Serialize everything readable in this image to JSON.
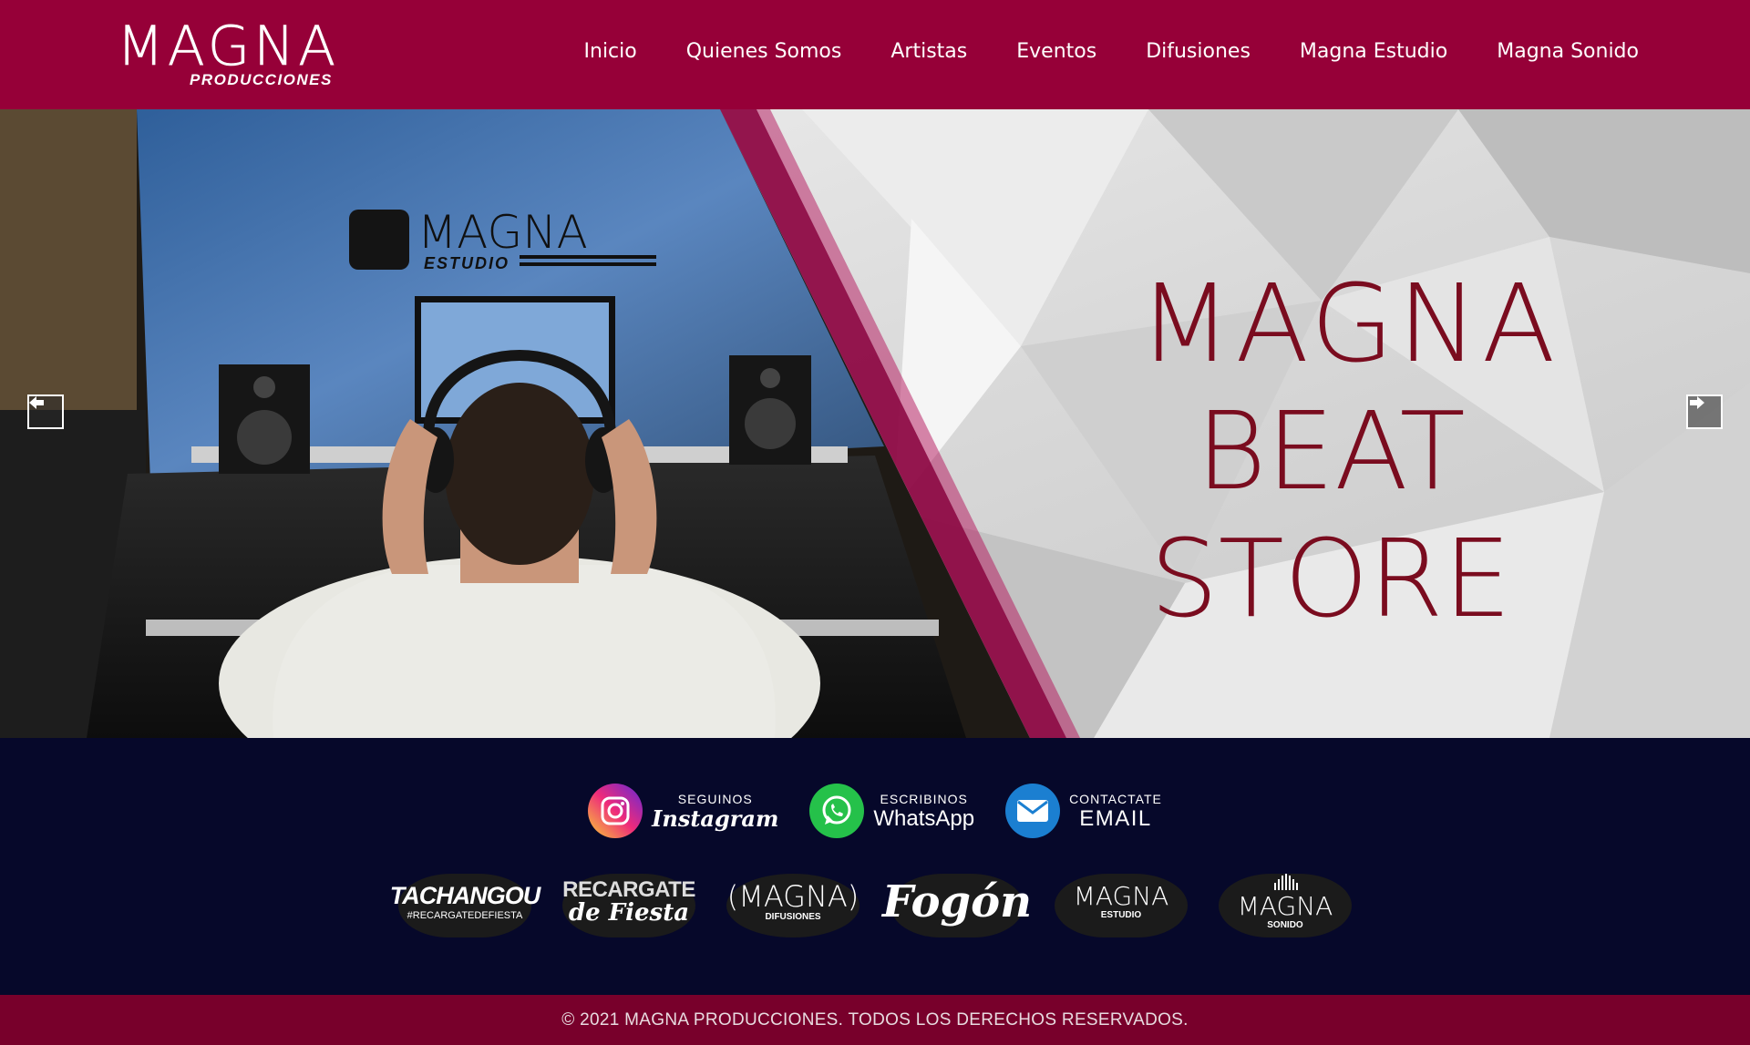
{
  "brand": {
    "name": "MAGNA",
    "subtitle": "PRODUCCIONES"
  },
  "nav": [
    "Inicio",
    "Quienes Somos",
    "Artistas",
    "Eventos",
    "Difusiones",
    "Magna Estudio",
    "Magna Sonido"
  ],
  "hero": {
    "photo_sign_main": "MAGNA",
    "photo_sign_sub": "ESTUDIO",
    "title_line1": "MAGNA",
    "title_line2": "BEAT STORE"
  },
  "social": [
    {
      "top": "SEGUINOS",
      "bottom": "Instagram",
      "icon": "instagram-icon"
    },
    {
      "top": "ESCRIBINOS",
      "bottom": "WhatsApp",
      "icon": "whatsapp-icon"
    },
    {
      "top": "CONTACTATE",
      "bottom": "EMAIL",
      "icon": "email-icon"
    }
  ],
  "brands": [
    {
      "main": "TACHANGOU",
      "sub": "#RECARGATEDEFIESTA"
    },
    {
      "main": "RECARGATE",
      "sub": "de Fiesta"
    },
    {
      "main": "(MAGNA)",
      "sub": "DIFUSIONES"
    },
    {
      "main": "Fogón",
      "sub": ""
    },
    {
      "main": "MAGNA",
      "sub": "ESTUDIO"
    },
    {
      "main": "MAGNA",
      "sub": "SONIDO"
    }
  ],
  "colors": {
    "header": "#960038",
    "footer": "#06082a",
    "copyright_bar": "#78002b",
    "hero_title": "#7a0c1f"
  },
  "copyright": "© 2021 MAGNA PRODUCCIONES. TODOS LOS DERECHOS RESERVADOS."
}
